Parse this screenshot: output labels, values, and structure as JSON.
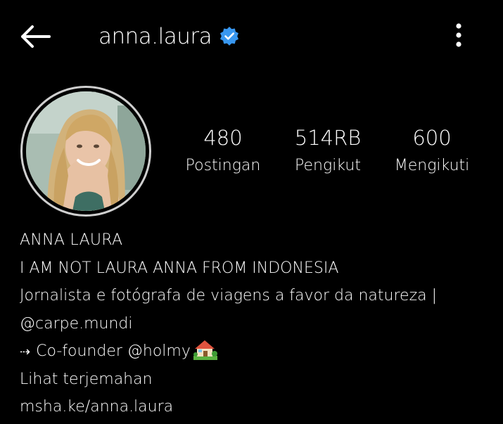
{
  "header": {
    "username": "anna.laura",
    "verified_icon": "verified-badge-icon",
    "back_icon": "arrow-left-icon",
    "menu_icon": "more-vertical-icon"
  },
  "stats": [
    {
      "value": "480",
      "label": "Postingan"
    },
    {
      "value": "514RB",
      "label": "Pengikut"
    },
    {
      "value": "600",
      "label": "Mengikuti"
    }
  ],
  "bio": {
    "name": "ANNA LAURA",
    "line1": "I AM NOT LAURA ANNA FROM INDONESIA",
    "line2": "Jornalista e fotógrafa de viagens a favor da natureza |",
    "mention1": "@carpe.mundi",
    "arrow": "⇢",
    "cofounder_prefix": "Co-founder ",
    "mention2": "@holmy",
    "house_icon": "house-with-garden-emoji",
    "translate": "Lihat terjemahan",
    "link": "msha.ke/anna.laura"
  },
  "colors": {
    "background": "#000000",
    "text": "#ffffff",
    "verified": "#3897f0",
    "avatar_ring": "#cfcfcf"
  }
}
